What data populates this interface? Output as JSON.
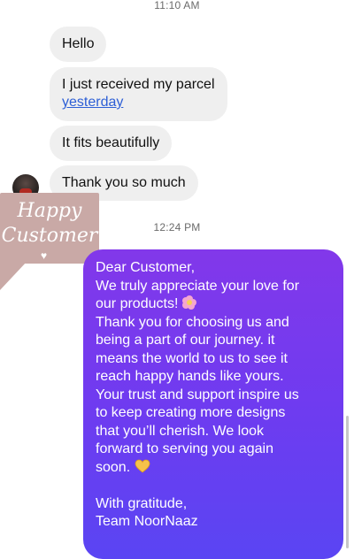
{
  "timestamps": {
    "first": "11:10 AM",
    "second": "12:24 PM"
  },
  "incoming_messages": [
    {
      "text": "Hello"
    },
    {
      "text_line1": "I just received my parcel",
      "link_text": "yesterday"
    },
    {
      "text": "It fits beautifully"
    },
    {
      "text": "Thank you so much"
    }
  ],
  "sticker": {
    "line1": "Happy",
    "line2": "Customer",
    "colors": {
      "background": "#c9a9a6",
      "text": "#ffffff"
    }
  },
  "outgoing_message": {
    "lines": [
      "Dear Customer,",
      "We truly appreciate your love for",
      "our products!",
      "Thank you for choosing us and",
      "being a part of our journey. it",
      "means the world to us to see it",
      "reach happy hands like yours.",
      "Your trust and support inspire us",
      "to keep creating more designs",
      "that you’ll cherish. We look",
      "forward to serving you again",
      "soon.",
      "",
      "With gratitude,",
      "Team NoorNaaz"
    ],
    "emojis": {
      "line3": "cherry-blossom-icon",
      "line12": "yellow-heart-icon"
    },
    "colors": {
      "gradient_top": "#8238ea",
      "gradient_bottom": "#5a45f3",
      "text": "#ffffff"
    }
  },
  "colors": {
    "incoming_bubble": "#efefef",
    "link": "#2d5fd6",
    "timestamp": "#6b6b6b"
  }
}
